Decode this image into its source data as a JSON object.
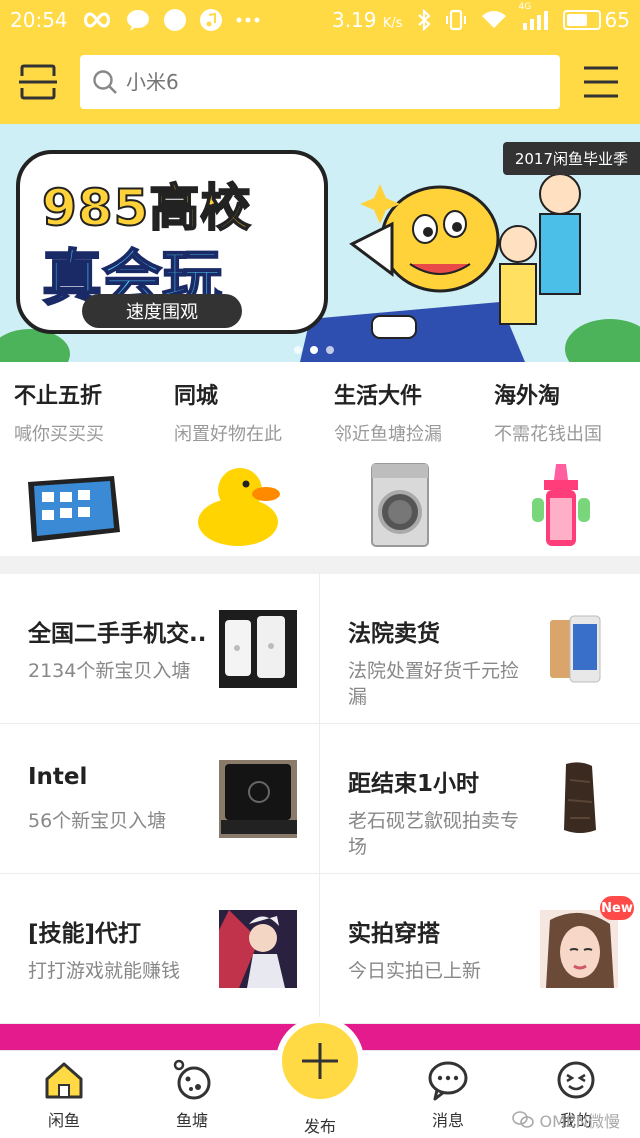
{
  "status_bar": {
    "time": "20:54",
    "speed": "3.19",
    "speed_unit": "K/s",
    "network": "4G",
    "battery": "65",
    "battery_level": 0.65
  },
  "search": {
    "placeholder": "小米6"
  },
  "banner": {
    "badge": "2017闲鱼毕业季",
    "headline1": "985高校",
    "headline2": "真会玩",
    "cta": "速度围观",
    "slide_count": 3,
    "active_slide": 1
  },
  "categories": [
    {
      "title": "不止五折",
      "subtitle": "喊你买买买",
      "icon": "ipad-image"
    },
    {
      "title": "同城",
      "subtitle": "闲置好物在此",
      "icon": "rubber-duck-image"
    },
    {
      "title": "生活大件",
      "subtitle": "邻近鱼塘捡漏",
      "icon": "washing-machine-image"
    },
    {
      "title": "海外淘",
      "subtitle": "不需花钱出国",
      "icon": "sippy-cup-image"
    }
  ],
  "grid": [
    {
      "title": "全国二手手机交..",
      "subtitle": "2134个新宝贝入塘",
      "icon": "iphone-image"
    },
    {
      "title": "法院卖货",
      "subtitle": "法院处置好货千元捡漏",
      "icon": "phone-image"
    },
    {
      "title": "Intel",
      "subtitle": "56个新宝贝入塘",
      "icon": "laptop-image"
    },
    {
      "title": "距结束1小时",
      "subtitle": "老石砚艺歙砚拍卖专场",
      "icon": "inkstone-image"
    },
    {
      "title": "[技能]代打",
      "subtitle": "打打游戏就能赚钱",
      "icon": "game-character-image"
    },
    {
      "title": "实拍穿搭",
      "subtitle": "今日实拍已上新",
      "icon": "portrait-image",
      "badge": "New"
    }
  ],
  "bottom_nav": [
    {
      "label": "闲鱼",
      "icon": "home-icon"
    },
    {
      "label": "鱼塘",
      "icon": "pond-icon"
    },
    {
      "label": "发布",
      "icon": "plus-icon"
    },
    {
      "label": "消息",
      "icon": "message-icon"
    },
    {
      "label": "我的",
      "icon": "profile-icon"
    }
  ],
  "watermark": "OMEN微慢",
  "colors": {
    "brand_yellow": "#ffda44",
    "promo_pink": "#e31b8c"
  }
}
